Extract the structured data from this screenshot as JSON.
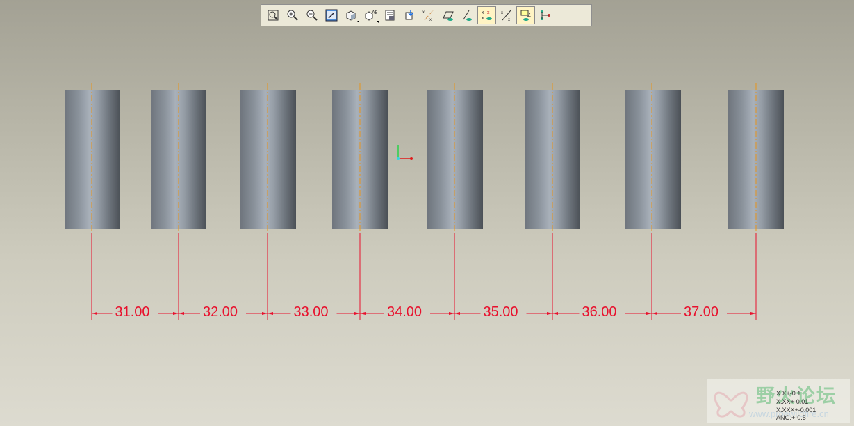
{
  "toolbar": {
    "buttons": [
      {
        "name": "refit-button",
        "icon": "refit-icon",
        "active": false
      },
      {
        "name": "zoom-in-button",
        "icon": "zoom-in-icon",
        "active": false
      },
      {
        "name": "zoom-out-button",
        "icon": "zoom-out-icon",
        "active": false
      },
      {
        "name": "repaint-button",
        "icon": "repaint-icon",
        "active": false
      },
      {
        "name": "display-style-button",
        "icon": "shaded-cube-icon",
        "active": false,
        "dropdown": true
      },
      {
        "name": "saved-views-button",
        "icon": "saved-views-icon",
        "active": false,
        "dropdown": true
      },
      {
        "name": "view-manager-button",
        "icon": "view-manager-icon",
        "active": false
      },
      {
        "name": "orient-button",
        "icon": "orient-icon",
        "active": false
      },
      {
        "name": "datum-axis-display-button",
        "icon": "datum-axis-icon",
        "active": false
      },
      {
        "name": "datum-plane-display-button",
        "icon": "datum-plane-icon",
        "active": false
      },
      {
        "name": "axis-display-button",
        "icon": "axis-eye-icon",
        "active": false
      },
      {
        "name": "point-display-button",
        "icon": "point-display-icon",
        "active": true
      },
      {
        "name": "csys-display-button",
        "icon": "csys-display-icon",
        "active": false
      },
      {
        "name": "annotation-display-button",
        "icon": "annotation-display-icon",
        "active": true
      },
      {
        "name": "spin-center-button",
        "icon": "spin-center-icon",
        "active": false
      }
    ]
  },
  "colors": {
    "dimension": "#e8112d",
    "centerline": "#e8941a",
    "background_top": "#a3a194",
    "background_bottom": "#dddbd0"
  },
  "dimensions": [
    "31.00",
    "32.00",
    "33.00",
    "34.00",
    "35.00",
    "36.00",
    "37.00"
  ],
  "watermark": {
    "logo_text": "野火论坛",
    "url": "www.proewildfire.cn"
  },
  "tolerances": [
    "X.X+-0.1",
    "X.XX+-0.01",
    "X.XXX+-0.001",
    "ANG.+-0.5"
  ]
}
